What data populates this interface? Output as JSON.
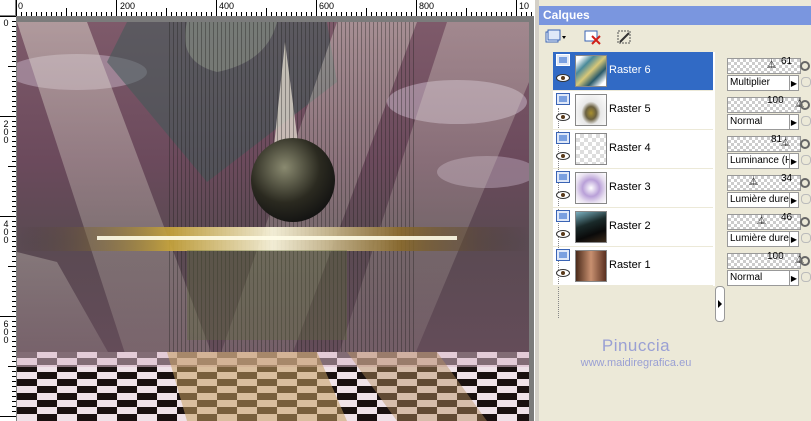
{
  "ruler": {
    "top_labels": [
      "0",
      "200",
      "400",
      "600",
      "800",
      "10"
    ],
    "left_labels": [
      "0",
      "2\n0\n0",
      "4\n0\n0",
      "6\n0\n0"
    ]
  },
  "watermark": {
    "name": "Pinuccia",
    "url": "www.maidiregrafica.eu"
  },
  "palette": {
    "title": "Calques",
    "toolbar": {
      "new_layer_icon": "new-layer-icon",
      "delete_layer_icon": "delete-layer-icon",
      "mask_icon": "mask-icon"
    },
    "layers": [
      {
        "name": "Raster 6",
        "opacity": "61",
        "blend": "Multiplier",
        "selected": true
      },
      {
        "name": "Raster 5",
        "opacity": "100",
        "blend": "Normal",
        "selected": false
      },
      {
        "name": "Raster 4",
        "opacity": "81",
        "blend": "Luminance (H)",
        "selected": false
      },
      {
        "name": "Raster 3",
        "opacity": "34",
        "blend": "Lumière dure",
        "selected": false
      },
      {
        "name": "Raster 2",
        "opacity": "46",
        "blend": "Lumière dure",
        "selected": false
      },
      {
        "name": "Raster 1",
        "opacity": "100",
        "blend": "Normal",
        "selected": false
      }
    ]
  },
  "colors": {
    "title_bar": "#7a96df",
    "selection": "#316ac5",
    "watermark": "#9aa0d4"
  }
}
